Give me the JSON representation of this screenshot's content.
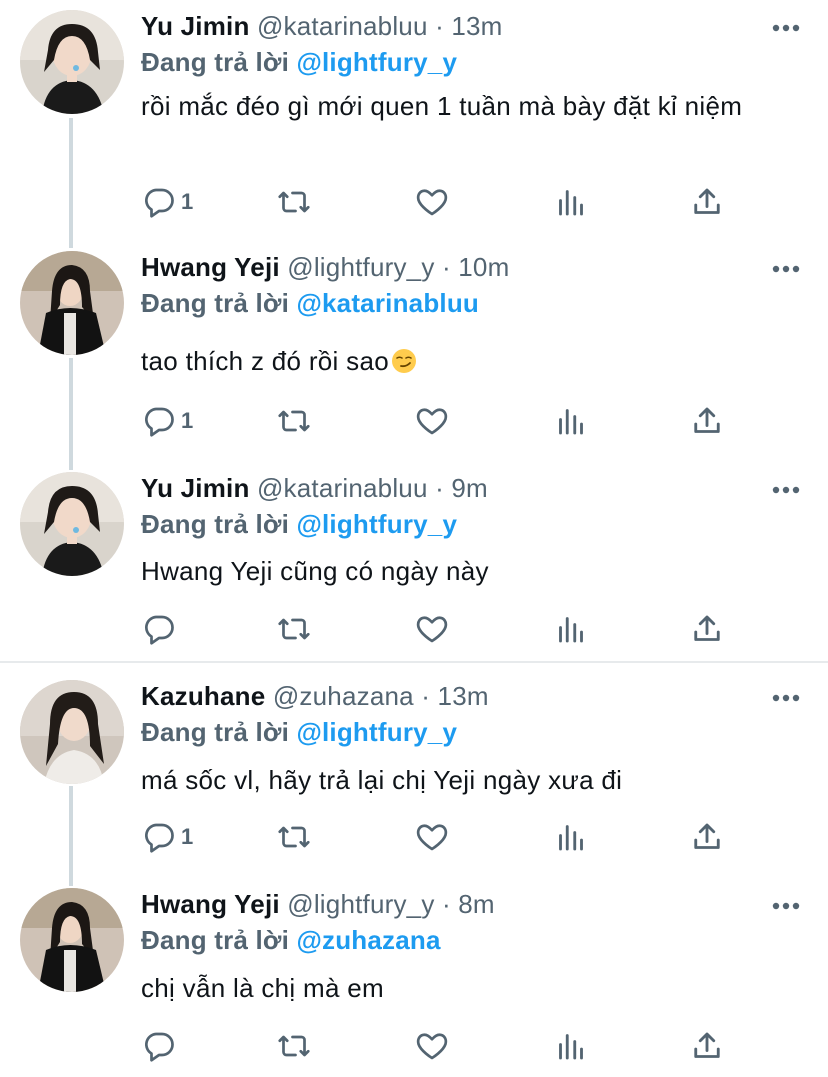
{
  "tweets": [
    {
      "name": "Yu Jimin",
      "handle": "@katarinabluu",
      "dot": "·",
      "time": "13m",
      "reply_label": "Đang trả lời",
      "reply_handle": "@lightfury_y",
      "text": "rồi mắc đéo gì mới quen 1 tuần mà bày đặt kỉ niệm",
      "reply_count": "1"
    },
    {
      "name": "Hwang Yeji",
      "handle": "@lightfury_y",
      "dot": "·",
      "time": "10m",
      "reply_label": "Đang trả lời",
      "reply_handle": "@katarinabluu",
      "text": "tao thích z đó rồi sao",
      "emoji": "smirk-emoji",
      "reply_count": "1"
    },
    {
      "name": "Yu Jimin",
      "handle": "@katarinabluu",
      "dot": "·",
      "time": "9m",
      "reply_label": "Đang trả lời",
      "reply_handle": "@lightfury_y",
      "text": "Hwang Yeji cũng có ngày này",
      "reply_count": ""
    },
    {
      "name": "Kazuhane",
      "handle": "@zuhazana",
      "dot": "·",
      "time": "13m",
      "reply_label": "Đang trả lời",
      "reply_handle": "@lightfury_y",
      "text": "má sốc vl, hãy trả lại chị Yeji ngày xưa đi",
      "reply_count": "1"
    },
    {
      "name": "Hwang Yeji",
      "handle": "@lightfury_y",
      "dot": "·",
      "time": "8m",
      "reply_label": "Đang trả lời",
      "reply_handle": "@zuhazana",
      "text": "chị vẫn là chị mà em",
      "reply_count": ""
    }
  ],
  "icons": {
    "reply": "reply-icon",
    "retweet": "retweet-icon",
    "like": "heart-icon",
    "stats": "stats-icon",
    "share": "share-icon",
    "more": "more-icon"
  },
  "colors": {
    "link": "#1d9bf0",
    "secondary": "#536471",
    "thread_line": "#cfd9de"
  }
}
